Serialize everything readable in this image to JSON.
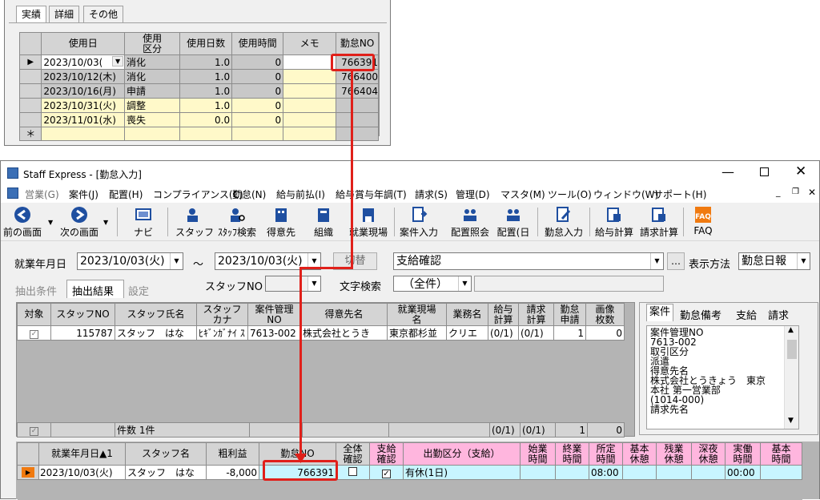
{
  "popup": {
    "tabs": [
      "実績",
      "詳細",
      "その他"
    ],
    "headers": [
      "使用日",
      "使用\n区分",
      "使用日数",
      "使用時間",
      "メモ",
      "勤怠NO"
    ],
    "rows": [
      {
        "date": "2023/10/03(",
        "kubun": "消化",
        "days": "1.0",
        "hours": "0",
        "memo": "",
        "no": "766391"
      },
      {
        "date": "2023/10/12(木)",
        "kubun": "消化",
        "days": "1.0",
        "hours": "0",
        "memo": "",
        "no": "766400"
      },
      {
        "date": "2023/10/16(月)",
        "kubun": "申請",
        "days": "1.0",
        "hours": "0",
        "memo": "",
        "no": "766404"
      },
      {
        "date": "2023/10/31(火)",
        "kubun": "調整",
        "days": "1.0",
        "hours": "0",
        "memo": "",
        "no": ""
      },
      {
        "date": "2023/11/01(水)",
        "kubun": "喪失",
        "days": "0.0",
        "hours": "0",
        "memo": "",
        "no": ""
      }
    ],
    "new_row_marker": "＊",
    "current_row_marker": "▶"
  },
  "window": {
    "title": "Staff Express - [勤怠入力]",
    "menu": [
      "営業(G)",
      "案件(J)",
      "配置(H)",
      "コンプライアンス(C)",
      "勤怠(N)",
      "給与前払(I)",
      "給与賞与年調(T)",
      "請求(S)",
      "管理(D)",
      "マスタ(M)",
      "ツール(O)",
      "ウィンドウ(W)",
      "サポート(H)"
    ],
    "toolbar": [
      "前の画面",
      "次の画面",
      "ナビ",
      "スタッフ",
      "ｽﾀｯﾌ検索",
      "得意先",
      "組織",
      "就業現場",
      "案件入力",
      "配置照会",
      "配置(日",
      "勤怠入力",
      "給与計算",
      "請求計算",
      "FAQ"
    ]
  },
  "filter": {
    "date_label": "就業年月日",
    "date_from": "2023/10/03(火)",
    "tilde": "～",
    "date_to": "2023/10/03(火)",
    "switch_button": "切替",
    "mode_value": "支給確認",
    "ellipsis": "…",
    "display_method_label": "表示方法",
    "display_method_value": "勤怠日報",
    "staff_no_label": "スタッフNO",
    "text_search_label": "文字検索",
    "text_search_value": "（全件）"
  },
  "tabs": [
    "抽出条件",
    "抽出結果",
    "設定"
  ],
  "upper_grid": {
    "headers": [
      "対象",
      "スタッフNO",
      "スタッフ氏名",
      "スタッフ\nカナ",
      "案件管理\nNO",
      "得意先名",
      "就業現場\n名",
      "業務名",
      "給与\n計算",
      "請求\n計算",
      "勤怠\n申請",
      "画像\n枚数"
    ],
    "row": [
      "",
      "115787",
      "スタッフ　はな",
      "ﾋｷﾞﾝｶﾞﾅｲ ｽ",
      "7613-002",
      "株式会社とうき",
      "東京都杉並",
      "クリエ",
      "(0/1)",
      "(0/1)",
      "1",
      "0"
    ],
    "footer_count": "件数 1件",
    "footer_vals": [
      "(0/1)",
      "(0/1)",
      "1",
      "0"
    ]
  },
  "side_panel": {
    "tabs": [
      "案件",
      "勤怠備考",
      "支給",
      "請求"
    ],
    "lines": [
      "案件管理NO",
      "7613-002",
      "取引区分",
      "派遣",
      "得意先名",
      "株式会社とうきょう　東京",
      "本社 第一営業部",
      "(1014-000)",
      "請求先名"
    ]
  },
  "lower_grid": {
    "headers": [
      "就業年月日▲1",
      "スタッフ名",
      "粗利益",
      "勤怠NO",
      "全体\n確認",
      "支給\n確認",
      "出勤区分（支給）",
      "始業\n時間",
      "終業\n時間",
      "所定\n時間",
      "基本\n休憩",
      "残業\n休憩",
      "深夜\n休憩",
      "実働\n時間",
      "基本\n時間"
    ],
    "row": [
      "2023/10/03(火)",
      "スタッフ　はな",
      "-8,000",
      "766391",
      "",
      "",
      "有休(1日)",
      "",
      "",
      "08:00",
      "",
      "",
      "",
      "00:00",
      ""
    ]
  },
  "colors": {
    "highlight": "#e0201a",
    "yellow": "#fff9c9",
    "pink": "#ffb6de",
    "cyan": "#c8f5ff"
  }
}
